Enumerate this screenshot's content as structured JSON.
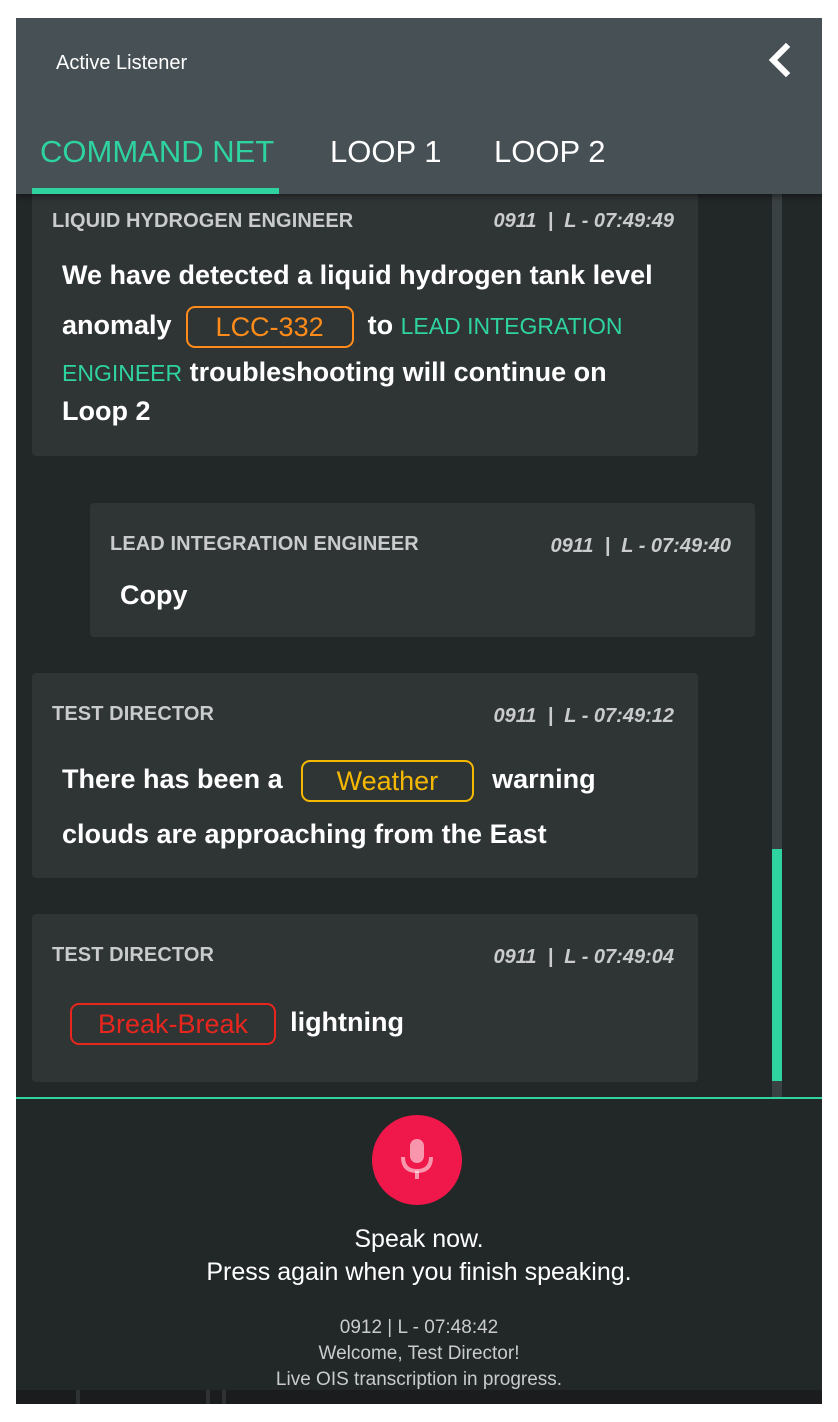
{
  "app": {
    "title": "Active Listener"
  },
  "tabs": [
    {
      "label": "COMMAND NET",
      "active": true
    },
    {
      "label": "LOOP 1",
      "active": false
    },
    {
      "label": "LOOP 2",
      "active": false
    }
  ],
  "messages": [
    {
      "speaker": "LIQUID HYDROGEN ENGINEER",
      "stamp": "0911  |  L - 07:49:49",
      "text_1": "We have detected a liquid hydrogen tank level",
      "text_2": "anomaly",
      "tag": "LCC-332",
      "text_3": "to",
      "mention_1": "LEAD INTEGRATION",
      "mention_2": "ENGINEER",
      "text_4": " troubleshooting will continue on",
      "text_5": "Loop 2"
    },
    {
      "speaker": "LEAD INTEGRATION ENGINEER",
      "stamp": "0911  |  L - 07:49:40",
      "text_1": "Copy"
    },
    {
      "speaker": "TEST DIRECTOR",
      "stamp": "0911  |  L - 07:49:12",
      "text_1": "There has been a",
      "tag": "Weather",
      "text_2": "warning",
      "text_3": "clouds are approaching from the East"
    },
    {
      "speaker": "TEST DIRECTOR",
      "stamp": "0911  |  L - 07:49:04",
      "tag": "Break-Break",
      "text_1": "lightning"
    }
  ],
  "speech": {
    "prompt_1": "Speak now.",
    "prompt_2": "Press again when you finish speaking."
  },
  "status": {
    "line_1": "0912 | L - 07:48:42",
    "line_2": "Welcome, Test Director!",
    "line_3": "Live OIS transcription in progress."
  },
  "colors": {
    "accent": "#2ed3a0",
    "header": "#475055",
    "background": "#222728",
    "card": "#2f3435",
    "tag_lcc": "#ff8c1a",
    "tag_weather": "#f5b800",
    "tag_break": "#e8261e",
    "mic": "#f0184a"
  },
  "icons": {
    "back": "chevron-left-icon",
    "mic": "microphone-icon"
  }
}
